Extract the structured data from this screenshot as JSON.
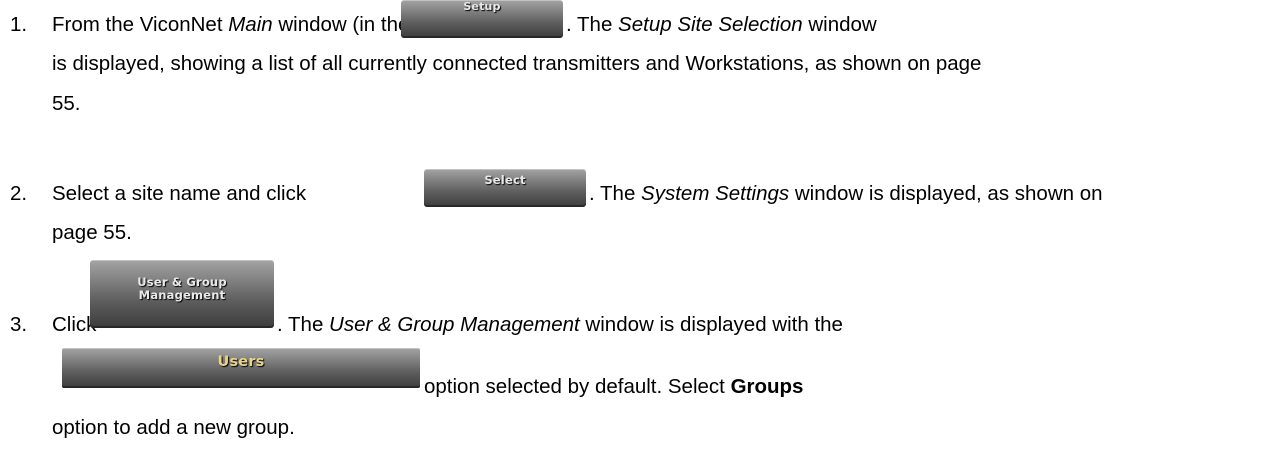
{
  "buttons": {
    "setup": "Setup",
    "select": "Select",
    "user_group_management": "User & Group\nManagement",
    "users": "Users"
  },
  "steps": [
    {
      "number": "1.",
      "line1_a": "From the ViconNet ",
      "line1_main": "Main",
      "line1_b": " window (in the Nucleus), click",
      "line1_c": ". The ",
      "line1_setup_site": "Setup Site Selection",
      "line1_d": " window",
      "line2": "is displayed, showing a list of all currently connected transmitters and Workstations, as shown on page",
      "line3": "55."
    },
    {
      "number": "2.",
      "line1_a": "Select a site name and click",
      "line1_b": ". The ",
      "line1_system_settings": "System Settings",
      "line1_c": " window is displayed, as shown on",
      "line2": "page 55."
    },
    {
      "number": "3.",
      "line1_a": "Click",
      "line1_b": ". The ",
      "line1_ugm": "User & Group Management",
      "line1_c": " window is displayed with the",
      "line2_a": " option selected by default. Select ",
      "line2_groups": "Groups",
      "line3": "option to add a new group."
    }
  ]
}
